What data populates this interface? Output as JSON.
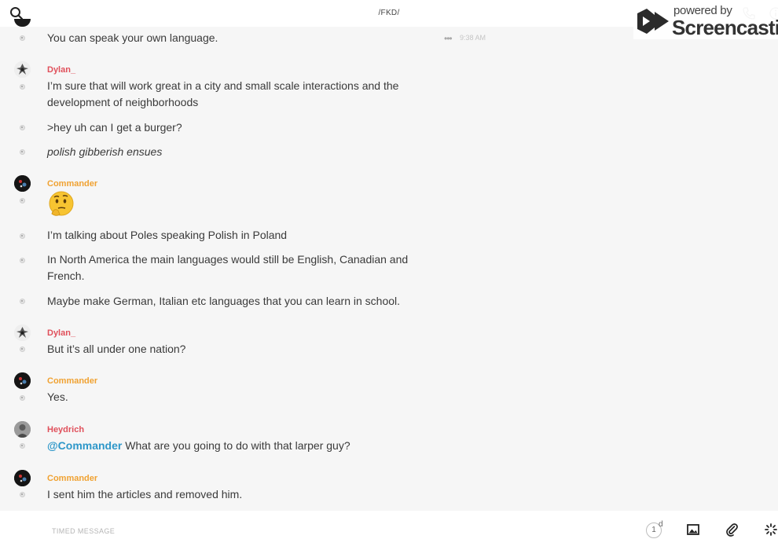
{
  "header": {
    "title": "/FKD/"
  },
  "watermark": {
    "small": "powered by",
    "big": "Screencastify"
  },
  "icons": {
    "search": "search-icon",
    "phone": "phone-icon",
    "info": "info-icon",
    "image": "image-icon",
    "attach": "paperclip-icon",
    "loading": "spinner-icon"
  },
  "colors": {
    "author_red": "#e0505b",
    "author_orange": "#f0a232",
    "mention": "#2e97c9"
  },
  "messages": {
    "first": {
      "text": "You can speak your own language.",
      "more": "•••",
      "time": "9:38 AM"
    },
    "dylan1": {
      "author": "Dylan_",
      "lines": [
        "I’m sure that will work great in a city and small scale interactions and the development of neighborhoods",
        ">hey uh can I get a burger?",
        "polish gibberish ensues"
      ]
    },
    "commander1": {
      "author": "Commander",
      "emoji": "thinking-face",
      "lines": [
        "I’m talking about Poles speaking Polish in Poland",
        "In North America the main languages would still be English, Canadian and French.",
        "Maybe make German, Italian etc languages that you can learn in school."
      ]
    },
    "dylan2": {
      "author": "Dylan_",
      "lines": [
        "But it’s all under one nation?"
      ]
    },
    "commander2": {
      "author": "Commander",
      "lines": [
        "Yes."
      ]
    },
    "heydrich": {
      "author": "Heydrich",
      "mention": "@Commander",
      "text": " What are you going to do with that larper guy?"
    },
    "commander3": {
      "author": "Commander",
      "lines": [
        "I sent him the articles and removed him."
      ]
    }
  },
  "composer": {
    "placeholder": "TIMED MESSAGE",
    "timer_value": "1",
    "timer_unit": "d"
  }
}
